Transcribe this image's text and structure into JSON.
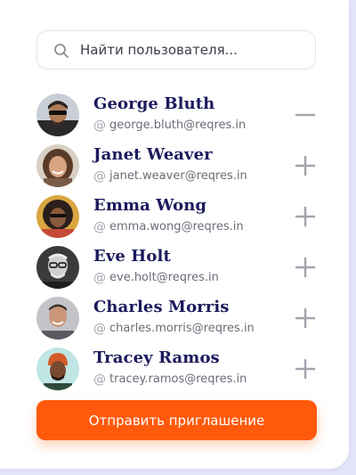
{
  "search": {
    "placeholder": "Найти пользователя...",
    "icon": "search-icon"
  },
  "users": [
    {
      "name": "George Bluth",
      "email": "george.bluth@reqres.in",
      "action": "remove",
      "action_icon": "minus-icon"
    },
    {
      "name": "Janet Weaver",
      "email": "janet.weaver@reqres.in",
      "action": "add",
      "action_icon": "plus-icon"
    },
    {
      "name": "Emma Wong",
      "email": "emma.wong@reqres.in",
      "action": "add",
      "action_icon": "plus-icon"
    },
    {
      "name": "Eve Holt",
      "email": "eve.holt@reqres.in",
      "action": "add",
      "action_icon": "plus-icon"
    },
    {
      "name": "Charles Morris",
      "email": "charles.morris@reqres.in",
      "action": "add",
      "action_icon": "plus-icon"
    },
    {
      "name": "Tracey Ramos",
      "email": "tracey.ramos@reqres.in",
      "action": "add",
      "action_icon": "plus-icon"
    }
  ],
  "email_prefix_icon": "at-icon",
  "send_button": {
    "label": "Отправить приглашение"
  },
  "colors": {
    "accent": "#ff5a0c",
    "name_text": "#1b1a5c",
    "email_text": "#6c6c78",
    "icon_gray": "#a4a4ae",
    "background": "#e3e4f8"
  }
}
